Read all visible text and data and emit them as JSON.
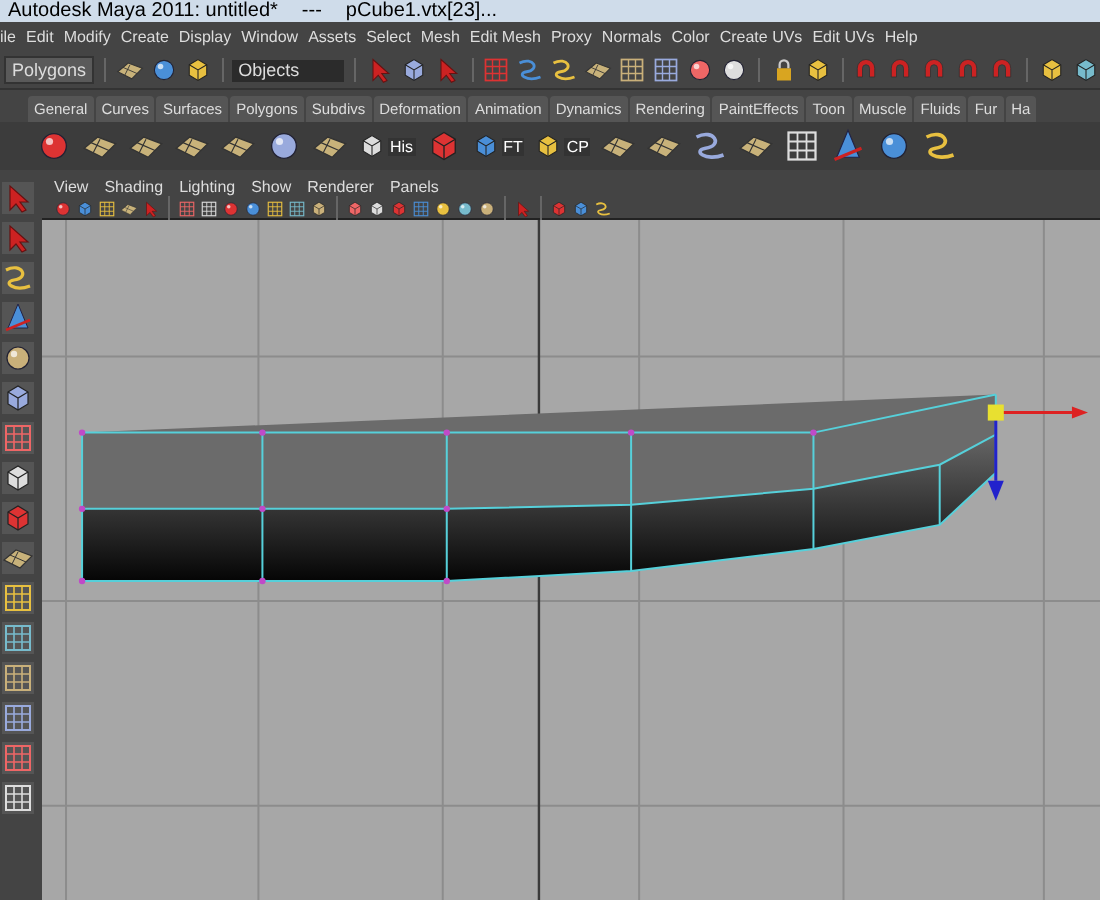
{
  "window": {
    "title": "Autodesk Maya 2011: untitled*",
    "separator": "---",
    "selection": "pCube1.vtx[23]..."
  },
  "menu_bar": [
    "ile",
    "Edit",
    "Modify",
    "Create",
    "Display",
    "Window",
    "Assets",
    "Select",
    "Mesh",
    "Edit Mesh",
    "Proxy",
    "Normals",
    "Color",
    "Create UVs",
    "Edit UVs",
    "Help"
  ],
  "status_line": {
    "menu_set": "Polygons",
    "selection_field": "Objects"
  },
  "shelf_tabs": [
    "General",
    "Curves",
    "Surfaces",
    "Polygons",
    "Subdivs",
    "Deformation",
    "Animation",
    "Dynamics",
    "Rendering",
    "PaintEffects",
    "Toon",
    "Muscle",
    "Fluids",
    "Fur",
    "Ha"
  ],
  "shelf_labels": [
    "His",
    "FT",
    "CP"
  ],
  "panel_menu": [
    "View",
    "Shading",
    "Lighting",
    "Show",
    "Renderer",
    "Panels"
  ]
}
